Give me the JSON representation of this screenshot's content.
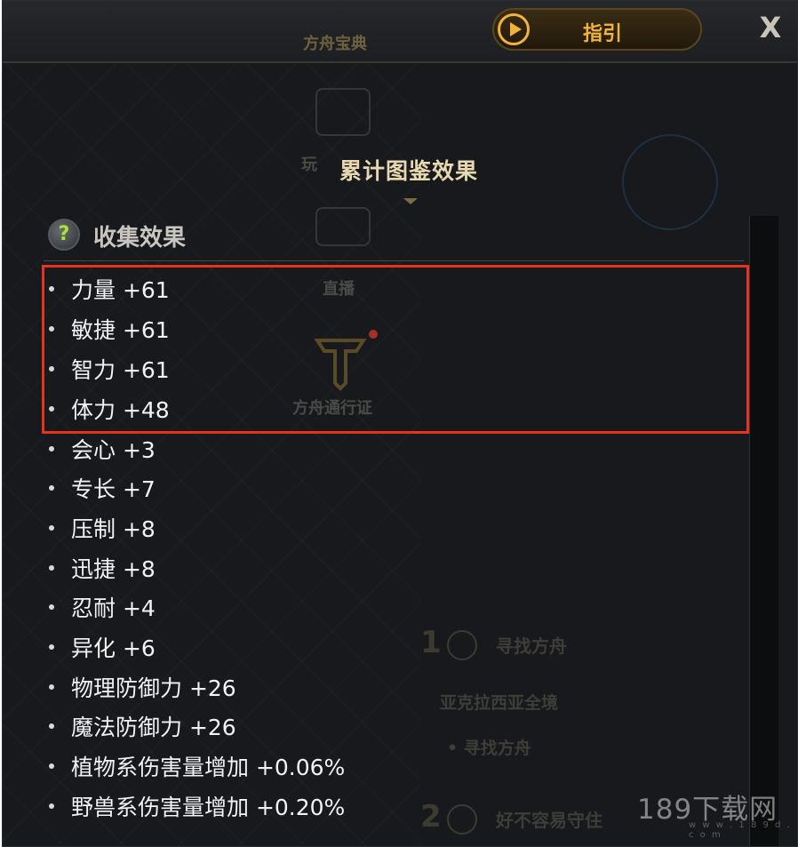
{
  "window": {
    "background_tab_label": "方舟宝典",
    "guide_button_label": "指引",
    "close_glyph": "X"
  },
  "background_nav": {
    "items": [
      {
        "label": "玩",
        "icon": "gift-icon"
      },
      {
        "label": "直播",
        "icon": "video-icon"
      },
      {
        "label": "方舟通行证",
        "icon": "emblem-icon"
      }
    ]
  },
  "panel": {
    "title": "累计图鉴效果",
    "section_title": "收集效果",
    "help_glyph": "?"
  },
  "stats": [
    {
      "label": "力量 +61",
      "highlighted": true
    },
    {
      "label": "敏捷 +61",
      "highlighted": true
    },
    {
      "label": "智力 +61",
      "highlighted": true
    },
    {
      "label": "体力 +48",
      "highlighted": true
    },
    {
      "label": "会心 +3"
    },
    {
      "label": "专长 +7"
    },
    {
      "label": "压制 +8"
    },
    {
      "label": "迅捷 +8"
    },
    {
      "label": "忍耐 +4"
    },
    {
      "label": "异化 +6"
    },
    {
      "label": "物理防御力 +26"
    },
    {
      "label": "魔法防御力 +26"
    },
    {
      "label": "植物系伤害量增加 +0.06%"
    },
    {
      "label": "野兽系伤害量增加 +0.20%"
    }
  ],
  "background_quests": {
    "step1_number": "1",
    "step1_title": "寻找方舟",
    "region": "亚克拉西亚全境",
    "step1_sub": "• 寻找方舟",
    "step2_number": "2",
    "step2_title": "好不容易守住"
  },
  "watermark": {
    "text": "189下载网",
    "sub": "w w w . 1 8 9 d . c o m"
  },
  "colors": {
    "accent_gold": "#f0b43a",
    "title_text": "#e8d8b0",
    "highlight_border": "#e8321c",
    "panel_bg": "#17191c"
  }
}
